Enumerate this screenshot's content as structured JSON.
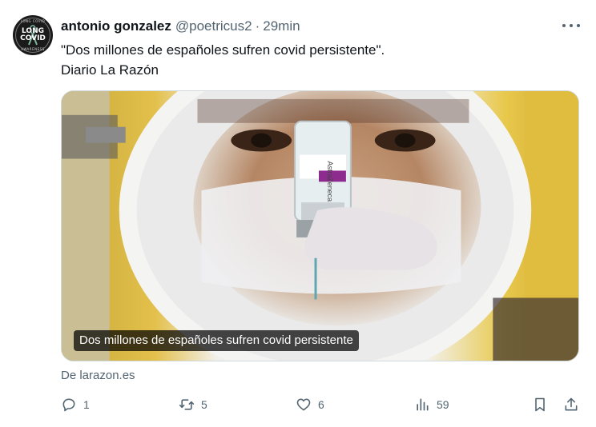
{
  "author": {
    "name": "antonio gonzalez",
    "handle": "@poetricus2",
    "separator": "·",
    "time": "29min",
    "avatar_text_line1": "LONG",
    "avatar_text_line2": "COVID",
    "avatar_arc_top": "LONG COVID",
    "avatar_arc_bottom": "AWARENESS"
  },
  "tweet": {
    "text_line1": "\"Dos millones de españoles sufren covid persistente\".",
    "text_line2": "Diario La Razón"
  },
  "card": {
    "caption": "Dos millones de españoles sufren covid persistente",
    "vial_label": "AstraZeneca",
    "source": "De larazon.es"
  },
  "actions": {
    "reply_count": "1",
    "retweet_count": "5",
    "like_count": "6",
    "views_count": "59"
  },
  "icons": {
    "more": "more-dots-icon",
    "reply": "reply-icon",
    "retweet": "retweet-icon",
    "like": "heart-icon",
    "views": "views-icon",
    "bookmark": "bookmark-icon",
    "share": "share-icon"
  },
  "colors": {
    "text": "#0f1419",
    "secondary": "#536471",
    "border": "#cfd9de"
  }
}
